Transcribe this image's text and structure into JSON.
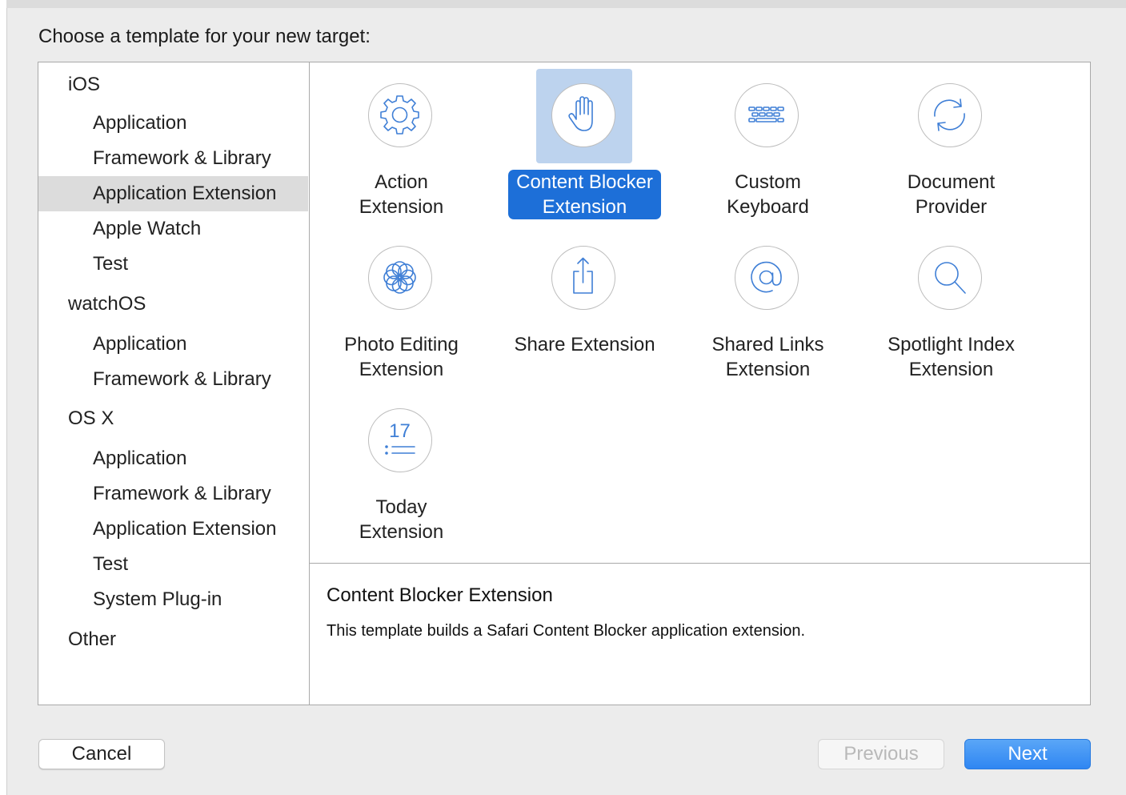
{
  "heading": "Choose a template for your new target:",
  "sidebar": {
    "groups": [
      {
        "label": "iOS",
        "items": [
          "Application",
          "Framework & Library",
          "Application Extension",
          "Apple Watch",
          "Test"
        ]
      },
      {
        "label": "watchOS",
        "items": [
          "Application",
          "Framework & Library"
        ]
      },
      {
        "label": "OS X",
        "items": [
          "Application",
          "Framework & Library",
          "Application Extension",
          "Test",
          "System Plug-in"
        ]
      },
      {
        "label": "Other",
        "items": []
      }
    ],
    "selected": "iOS / Application Extension"
  },
  "templates": [
    {
      "label": "Action\nExtension",
      "icon": "gear-icon"
    },
    {
      "label": "Content Blocker\nExtension",
      "icon": "hand-icon",
      "selected": true
    },
    {
      "label": "Custom\nKeyboard",
      "icon": "keyboard-icon"
    },
    {
      "label": "Document\nProvider",
      "icon": "sync-icon"
    },
    {
      "label": "Photo Editing\nExtension",
      "icon": "flower-icon"
    },
    {
      "label": "Share Extension",
      "icon": "share-icon"
    },
    {
      "label": "Shared Links\nExtension",
      "icon": "at-icon"
    },
    {
      "label": "Spotlight Index\nExtension",
      "icon": "magnifier-icon"
    },
    {
      "label": "Today\nExtension",
      "icon": "calendar-list-icon",
      "icon_text": "17"
    }
  ],
  "description": {
    "title": "Content Blocker Extension",
    "text": "This template builds a Safari Content Blocker application extension."
  },
  "buttons": {
    "cancel": "Cancel",
    "previous": "Previous",
    "next": "Next"
  },
  "colors": {
    "selection_blue": "#1d6fd8",
    "icon_tile_highlight": "#bdd3ee",
    "icon_stroke": "#3f7fd6",
    "sidebar_selected": "#dcdcdc"
  }
}
